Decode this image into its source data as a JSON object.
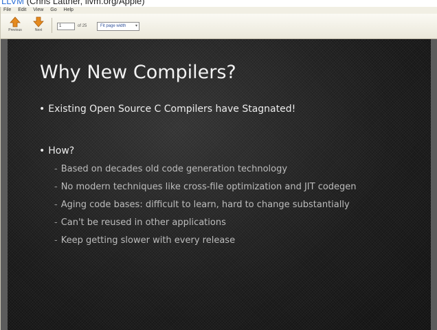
{
  "caption": {
    "link": "LLVM",
    "rest": "(Chris Lattner, llvm.org/Apple)"
  },
  "menubar": {
    "items": [
      "File",
      "Edit",
      "View",
      "Go",
      "Help"
    ]
  },
  "toolbar": {
    "buttons": [
      {
        "label": "Previous",
        "icon": "arrow-up-icon"
      },
      {
        "label": "Next",
        "icon": "arrow-down-icon"
      }
    ],
    "page_value": "1",
    "page_total": "of 25",
    "zoom_value": "Fit page width",
    "icon_color": "#e58a1f"
  },
  "slide": {
    "title": "Why New Compilers?",
    "bullets": [
      {
        "text": "Existing Open Source C Compilers have Stagnated!"
      },
      {
        "text": "How?"
      }
    ],
    "sub_bullets": [
      "Based on decades old code generation technology",
      "No modern techniques like cross-file optimization and JIT codegen",
      "Aging code bases: difficult to learn, hard to change substantially",
      "Can't be reused in other applications",
      "Keep getting slower with every release"
    ]
  }
}
